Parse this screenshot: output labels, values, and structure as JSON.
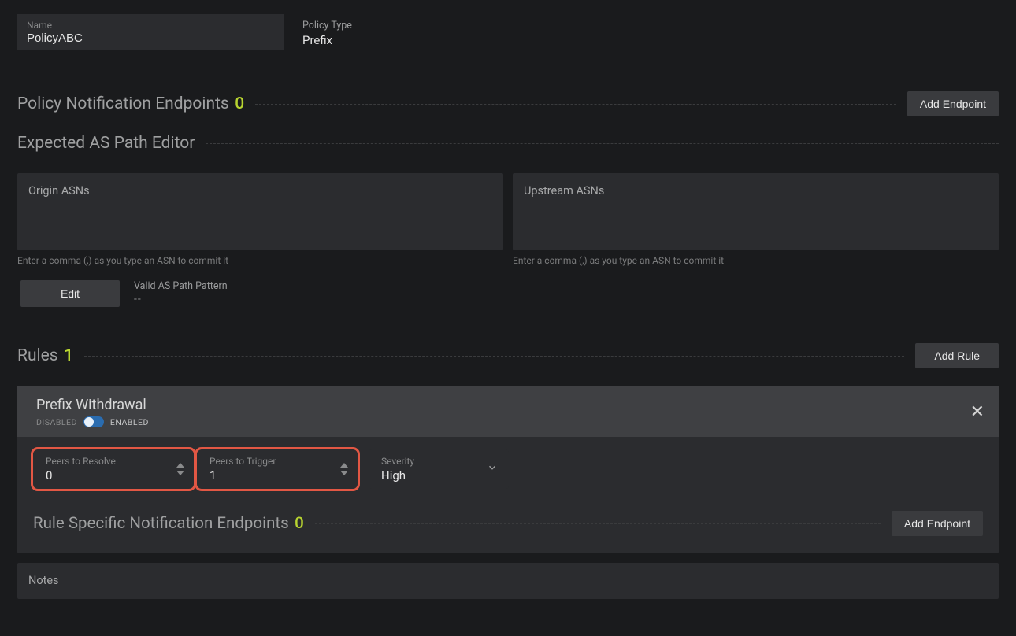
{
  "name_field": {
    "label": "Name",
    "value": "PolicyABC"
  },
  "policy_type": {
    "label": "Policy Type",
    "value": "Prefix"
  },
  "policy_endpoints": {
    "title": "Policy Notification Endpoints",
    "count": "0",
    "add_label": "Add Endpoint"
  },
  "as_path_editor": {
    "title": "Expected AS Path Editor",
    "origin_label": "Origin ASNs",
    "upstream_label": "Upstream ASNs",
    "hint": "Enter a comma (,) as you type an ASN to commit it",
    "edit_label": "Edit",
    "pattern_label": "Valid AS Path Pattern",
    "pattern_value": "--"
  },
  "rules": {
    "title": "Rules",
    "count": "1",
    "add_label": "Add Rule"
  },
  "rule": {
    "title": "Prefix Withdrawal",
    "disabled_label": "DISABLED",
    "enabled_label": "ENABLED",
    "peers_resolve": {
      "label": "Peers to Resolve",
      "value": "0"
    },
    "peers_trigger": {
      "label": "Peers to Trigger",
      "value": "1"
    },
    "severity": {
      "label": "Severity",
      "value": "High"
    },
    "rule_endpoints": {
      "title": "Rule Specific Notification Endpoints",
      "count": "0",
      "add_label": "Add Endpoint"
    }
  },
  "notes": {
    "label": "Notes"
  }
}
